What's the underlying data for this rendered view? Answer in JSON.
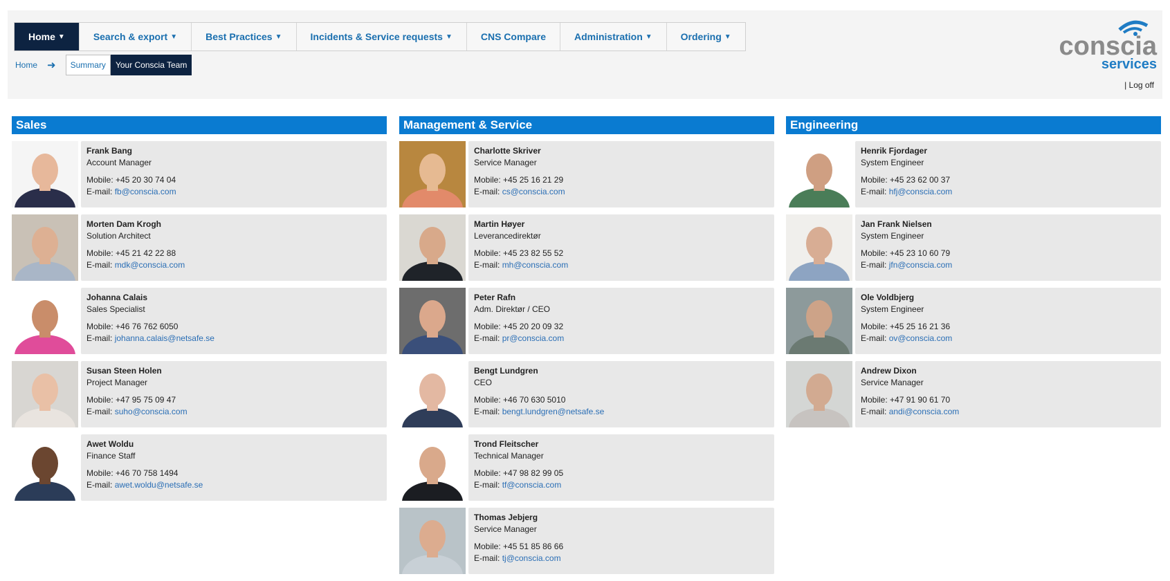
{
  "nav": [
    {
      "label": "Home",
      "active": true
    },
    {
      "label": "Search & export",
      "active": false
    },
    {
      "label": "Best Practices",
      "active": false
    },
    {
      "label": "Incidents & Service requests",
      "active": false
    },
    {
      "label": "CNS Compare",
      "active": false
    },
    {
      "label": "Administration",
      "active": false
    },
    {
      "label": "Ordering",
      "active": false
    }
  ],
  "breadcrumb": {
    "home": "Home",
    "arrow": "➜",
    "tabs": [
      "Summary",
      "Your Conscia Team"
    ]
  },
  "logo": {
    "top_text": "conscia",
    "bottom_text": "services"
  },
  "logoff": "| Log off",
  "labels": {
    "mobile": "Mobile:",
    "email": "E-mail:"
  },
  "colors": {
    "nav_active": "#0d2341",
    "link": "#1a6faf",
    "section_header": "#0a7bd1",
    "card_bg": "#e8e8e8",
    "logo_grey": "#8a8a8a",
    "logo_blue": "#1f7cc4"
  },
  "sections": [
    {
      "title": "Sales",
      "people": [
        {
          "name": "Frank Bang",
          "role": "Account Manager",
          "mobile": "+45 20 30 74 04",
          "email": "fb@conscia.com"
        },
        {
          "name": "Morten Dam Krogh",
          "role": "Solution Architect",
          "mobile": "+45 21 42 22 88",
          "email": "mdk@conscia.com"
        },
        {
          "name": "Johanna Calais",
          "role": "Sales Specialist",
          "mobile": "+46 76 762 6050",
          "email": "johanna.calais@netsafe.se"
        },
        {
          "name": "Susan Steen Holen",
          "role": "Project Manager",
          "mobile": "+47 95 75 09 47",
          "email": "suho@conscia.com"
        },
        {
          "name": "Awet Woldu",
          "role": "Finance Staff",
          "mobile": "+46 70 758 1494",
          "email": "awet.woldu@netsafe.se"
        }
      ]
    },
    {
      "title": "Management & Service",
      "people": [
        {
          "name": "Charlotte Skriver",
          "role": "Service Manager",
          "mobile": "+45 25 16 21 29",
          "email": "cs@conscia.com"
        },
        {
          "name": "Martin Høyer",
          "role": "Leverancedirektør",
          "mobile": "+45 23 82 55 52",
          "email": "mh@conscia.com"
        },
        {
          "name": "Peter Rafn",
          "role": "Adm. Direktør / CEO",
          "mobile": "+45 20 20 09 32",
          "email": "pr@conscia.com"
        },
        {
          "name": "Bengt Lundgren",
          "role": "CEO",
          "mobile": "+46 70 630 5010",
          "email": "bengt.lundgren@netsafe.se"
        },
        {
          "name": "Trond Fleitscher",
          "role": "Technical Manager",
          "mobile": "+47 98 82 99 05",
          "email": "tf@conscia.com"
        },
        {
          "name": "Thomas Jebjerg",
          "role": "Service Manager",
          "mobile": "+45 51 85 86 66",
          "email": "tj@conscia.com"
        }
      ]
    },
    {
      "title": "Engineering",
      "people": [
        {
          "name": "Henrik Fjordager",
          "role": "System Engineer",
          "mobile": "+45 23 62 00 37",
          "email": "hfj@conscia.com"
        },
        {
          "name": "Jan Frank Nielsen",
          "role": "System Engineer",
          "mobile": "+45 23 10 60 79",
          "email": "jfn@conscia.com"
        },
        {
          "name": "Ole Voldbjerg",
          "role": "System Engineer",
          "mobile": "+45 25 16 21 36",
          "email": "ov@conscia.com"
        },
        {
          "name": "Andrew Dixon",
          "role": "Service Manager",
          "mobile": "+47 91 90 61 70",
          "email": "andi@conscia.com"
        }
      ]
    }
  ]
}
